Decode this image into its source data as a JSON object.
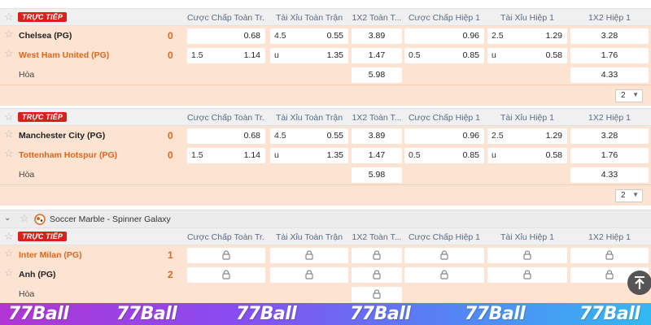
{
  "live_label": "TRỰC TIẾP",
  "columns": [
    "Cược Chấp Toàn Tr...",
    "Tài Xỉu Toàn Trận",
    "1X2 Toàn T...",
    "Cược Chấp Hiệp 1",
    "Tài Xỉu Hiệp 1",
    "1X2 Hiệp 1"
  ],
  "matches": [
    {
      "home": {
        "name": "Chelsea (PG)",
        "score": "0",
        "hc_line": "",
        "hc_odd": "0.68",
        "ou_line": "4.5",
        "ou_odd": "0.55",
        "x12": "3.89",
        "h1hc_line": "",
        "h1hc_odd": "0.96",
        "h1ou_line": "2.5",
        "h1ou_odd": "1.29",
        "h1x12": "3.28"
      },
      "away": {
        "name": "West Ham United (PG)",
        "score": "0",
        "hc_line": "1.5",
        "hc_odd": "1.14",
        "ou_line": "u",
        "ou_odd": "1.35",
        "x12": "1.47",
        "h1hc_line": "0.5",
        "h1hc_odd": "0.85",
        "h1ou_line": "u",
        "h1ou_odd": "0.58",
        "h1x12": "1.76"
      },
      "draw": {
        "label": "Hòa",
        "x12": "5.98",
        "h1x12": "4.33"
      },
      "page": "2"
    },
    {
      "home": {
        "name": "Manchester City (PG)",
        "score": "0",
        "hc_line": "",
        "hc_odd": "0.68",
        "ou_line": "4.5",
        "ou_odd": "0.55",
        "x12": "3.89",
        "h1hc_line": "",
        "h1hc_odd": "0.96",
        "h1ou_line": "2.5",
        "h1ou_odd": "1.29",
        "h1x12": "3.28"
      },
      "away": {
        "name": "Tottenham Hotspur (PG)",
        "score": "0",
        "hc_line": "1.5",
        "hc_odd": "1.14",
        "ou_line": "u",
        "ou_odd": "1.35",
        "x12": "1.47",
        "h1hc_line": "0.5",
        "h1hc_odd": "0.85",
        "h1ou_line": "u",
        "h1ou_odd": "0.58",
        "h1x12": "1.76"
      },
      "draw": {
        "label": "Hòa",
        "x12": "5.98",
        "h1x12": "4.33"
      },
      "page": "2"
    },
    {
      "home": {
        "name": "Inter Milan (PG)",
        "score": "1"
      },
      "away": {
        "name": "Anh (PG)",
        "score": "2"
      },
      "draw": {
        "label": "Hòa"
      }
    }
  ],
  "league": {
    "name": "Soccer Marble - Spinner Galaxy",
    "icon": "marble-icon"
  },
  "brand": [
    "77Ball",
    "77Ball",
    "77Ball",
    "77Ball",
    "77Ball",
    "77Ball"
  ],
  "colors": {
    "live": "#d8201c",
    "row_bg": "#fde3d2",
    "team_orange": "#e0661a",
    "score": "#e0661a"
  }
}
